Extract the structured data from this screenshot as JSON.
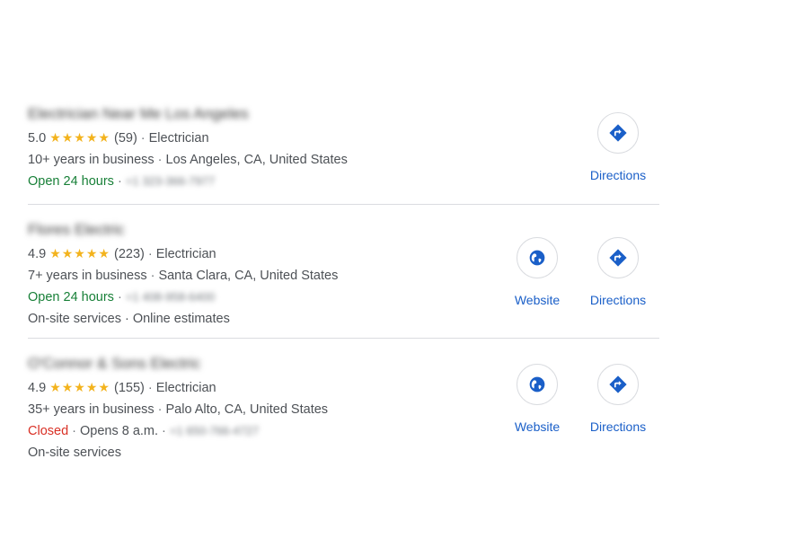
{
  "colors": {
    "accent": "#1a5fc8",
    "open": "#188038",
    "closed": "#d93025",
    "star": "#f3b31d"
  },
  "listings": [
    {
      "name": "Electrician Near Me Los Angeles",
      "rating": "5.0",
      "stars": "★★★★★",
      "reviews": "(59)",
      "category": "Electrician",
      "years": "10+ years in business",
      "location": "Los Angeles, CA, United States",
      "status": "Open 24 hours",
      "phone": "+1 323-366-7977",
      "services": "",
      "website_label": "",
      "directions_label": "Directions"
    },
    {
      "name": "Flores Electric",
      "rating": "4.9",
      "stars": "★★★★★",
      "reviews": "(223)",
      "category": "Electrician",
      "years": "7+ years in business",
      "location": "Santa Clara, CA, United States",
      "status": "Open 24 hours",
      "phone": "+1 408-958-6400",
      "services": "On-site services · Online estimates",
      "website_label": "Website",
      "directions_label": "Directions"
    },
    {
      "name": "O'Connor & Sons Electric",
      "rating": "4.9",
      "stars": "★★★★★",
      "reviews": "(155)",
      "category": "Electrician",
      "years": "35+ years in business",
      "location": "Palo Alto, CA, United States",
      "status": "Closed",
      "opens": "Opens 8 a.m.",
      "phone": "+1 650-766-4727",
      "services": "On-site services",
      "website_label": "Website",
      "directions_label": "Directions"
    }
  ]
}
